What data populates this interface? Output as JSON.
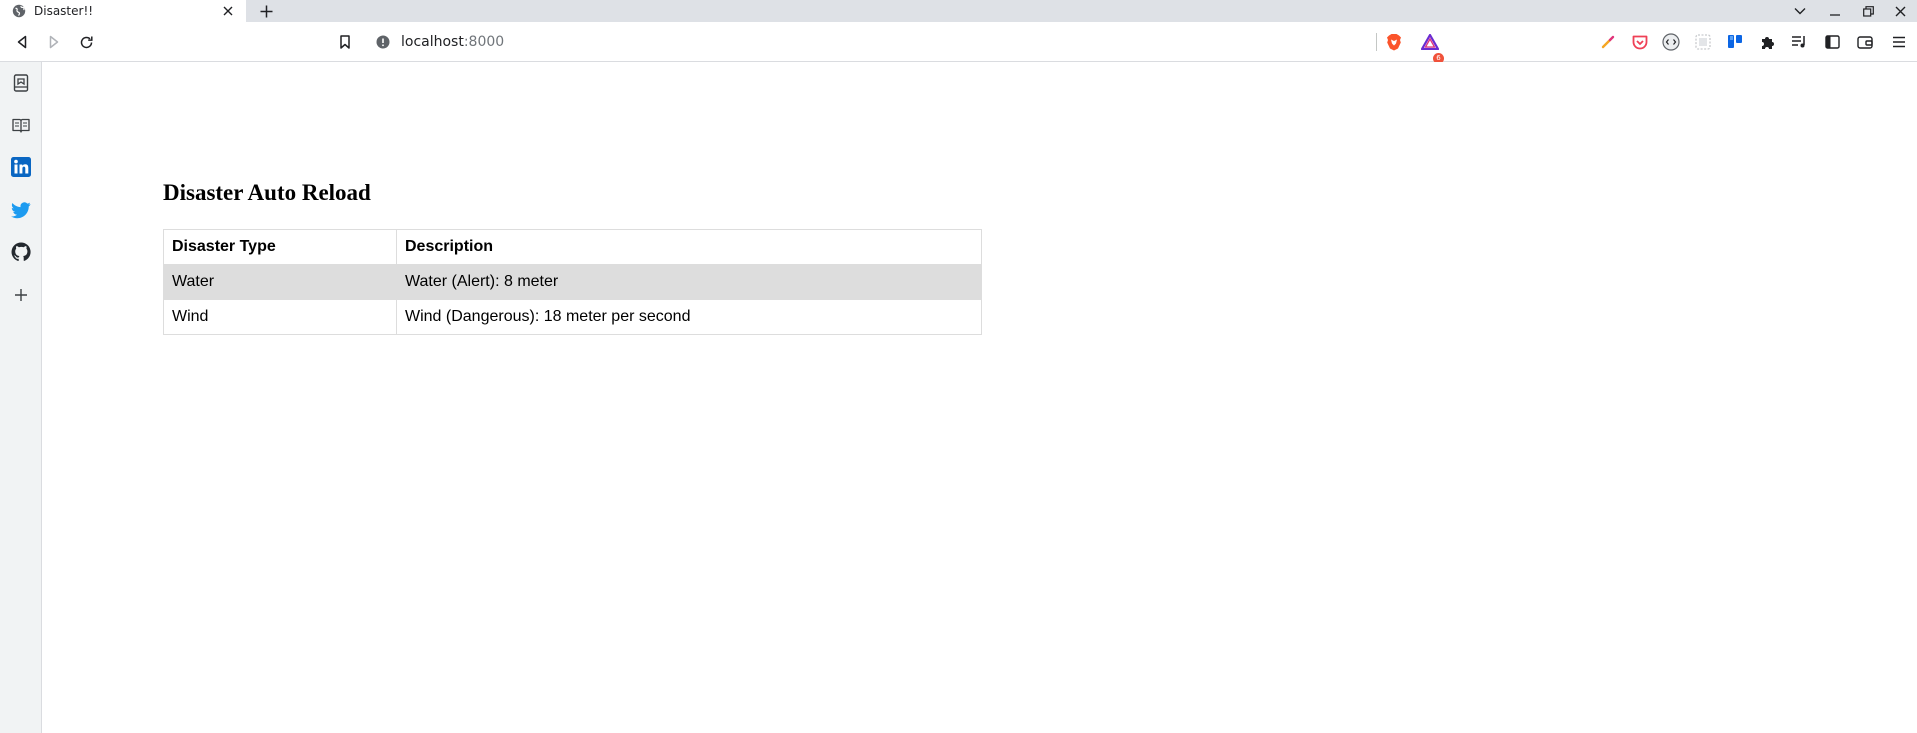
{
  "browser": {
    "tab": {
      "title": "Disaster!!",
      "favicon": "globe-icon",
      "close_icon": "close-icon"
    },
    "new_tab_icon": "plus-icon",
    "window_controls": [
      "tab-search-icon",
      "minimize-icon",
      "restore-icon",
      "close-icon"
    ],
    "toolbar": {
      "back_icon": "back-arrow-icon",
      "forward_icon": "forward-arrow-icon",
      "reload_icon": "reload-icon",
      "bookmark_icon": "bookmark-icon",
      "address": {
        "host": "localhost",
        "port": ":8000",
        "info_icon": "site-info-icon"
      },
      "shields_icon": "brave-shields-icon",
      "rewards_icon": "brave-rewards-icon",
      "rewards_badge": "6",
      "extensions": [
        "color-picker-icon",
        "pocket-icon",
        "wallet-extension-icon",
        "screenshot-icon",
        "trello-icon",
        "puzzle-icon",
        "playlist-icon",
        "sidebar-toggle-icon",
        "brave-wallet-icon",
        "menu-icon"
      ]
    },
    "sidebar": [
      "reading-list-icon",
      "reader-icon",
      "linkedin-icon",
      "twitter-icon",
      "github-icon",
      "add-icon"
    ],
    "colors": {
      "linkedin": "#0a66c2",
      "twitter": "#1d9bf0",
      "brave_orange": "#fb542b",
      "pocket": "#ef4056"
    }
  },
  "page": {
    "title": "Disaster Auto Reload",
    "table": {
      "headers": [
        "Disaster Type",
        "Description"
      ],
      "rows": [
        [
          "Water",
          "Water (Alert): 8 meter"
        ],
        [
          "Wind",
          "Wind (Dangerous): 18 meter per second"
        ]
      ]
    }
  }
}
